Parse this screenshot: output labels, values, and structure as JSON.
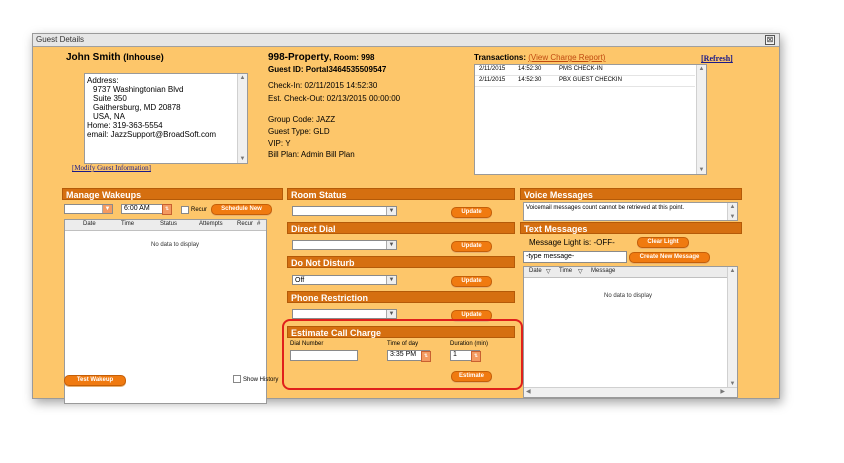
{
  "window": {
    "title": "Guest Details",
    "close": "⊠"
  },
  "guest": {
    "name": "John Smith",
    "status": "(Inhouse)",
    "address_lines": [
      "Address:",
      "9737 Washingtonian Blvd",
      "Suite 350",
      "Gaithersburg, MD 20878",
      "USA, NA",
      "Home:  319-363-5554",
      "email: JazzSupport@BroadSoft.com"
    ],
    "modify_link": "[Modify Guest Information]"
  },
  "property": {
    "name": "998-Property",
    "room": ", Room: 998",
    "guest_id": "Guest ID: Portal3464535509547",
    "check_in": "Check-In: 02/11/2015 14:52:30",
    "check_out": "Est. Check-Out: 02/13/2015 00:00:00",
    "group_code": "Group Code: JAZZ",
    "guest_type": "Guest Type: GLD",
    "vip": "VIP: Y",
    "bill_plan": "Bill Plan: Admin Bill Plan"
  },
  "transactions": {
    "label": "Transactions:",
    "view_report": "(View Charge Report)",
    "refresh": "[Refresh]",
    "rows": [
      {
        "date": "2/11/2015",
        "time": "14:52:30",
        "desc": "PMS CHECK-IN"
      },
      {
        "date": "2/11/2015",
        "time": "14:52:30",
        "desc": "PBX GUEST CHECKIN"
      }
    ]
  },
  "wakeups": {
    "title": "Manage Wakeups",
    "time_value": "6:00 AM",
    "recur_label": "Recur",
    "schedule_btn": "Schedule New",
    "columns": [
      "Date",
      "Time",
      "Status",
      "Attempts",
      "Recur",
      "#"
    ],
    "empty": "No data to display",
    "test_btn": "Test Wakeup",
    "show_history": "Show History"
  },
  "room_status": {
    "title": "Room Status",
    "value": "",
    "update": "Update"
  },
  "direct_dial": {
    "title": "Direct Dial",
    "value": "",
    "update": "Update"
  },
  "dnd": {
    "title": "Do Not Disturb",
    "value": "Off",
    "update": "Update"
  },
  "phone_restriction": {
    "title": "Phone Restriction",
    "value": "",
    "update": "Update"
  },
  "estimate": {
    "title": "Estimate Call Charge",
    "dial_label": "Dial Number",
    "time_label": "Time of day",
    "time_value": "3:35 PM",
    "duration_label": "Duration (min)",
    "duration_value": "1",
    "btn": "Estimate"
  },
  "voice": {
    "title": "Voice Messages",
    "text": "Voicemail messages count cannot be retrieved at this point."
  },
  "text_messages": {
    "title": "Text Messages",
    "light": "Message Light is: -OFF-",
    "clear_btn": "Clear Light",
    "placeholder": "-type message-",
    "create_btn": "Create New Message",
    "columns": [
      "Date",
      "Time",
      "Message"
    ],
    "empty": "No data to display"
  },
  "colors": {
    "panel": "#fdc66a",
    "header": "#d56f10",
    "button": "#f07a10",
    "highlight": "#e0201b"
  },
  "icons": {
    "close": "close-icon",
    "dropdown": "chevron-down-icon",
    "stepper": "stepper-icon",
    "sort": "sort-icon"
  }
}
